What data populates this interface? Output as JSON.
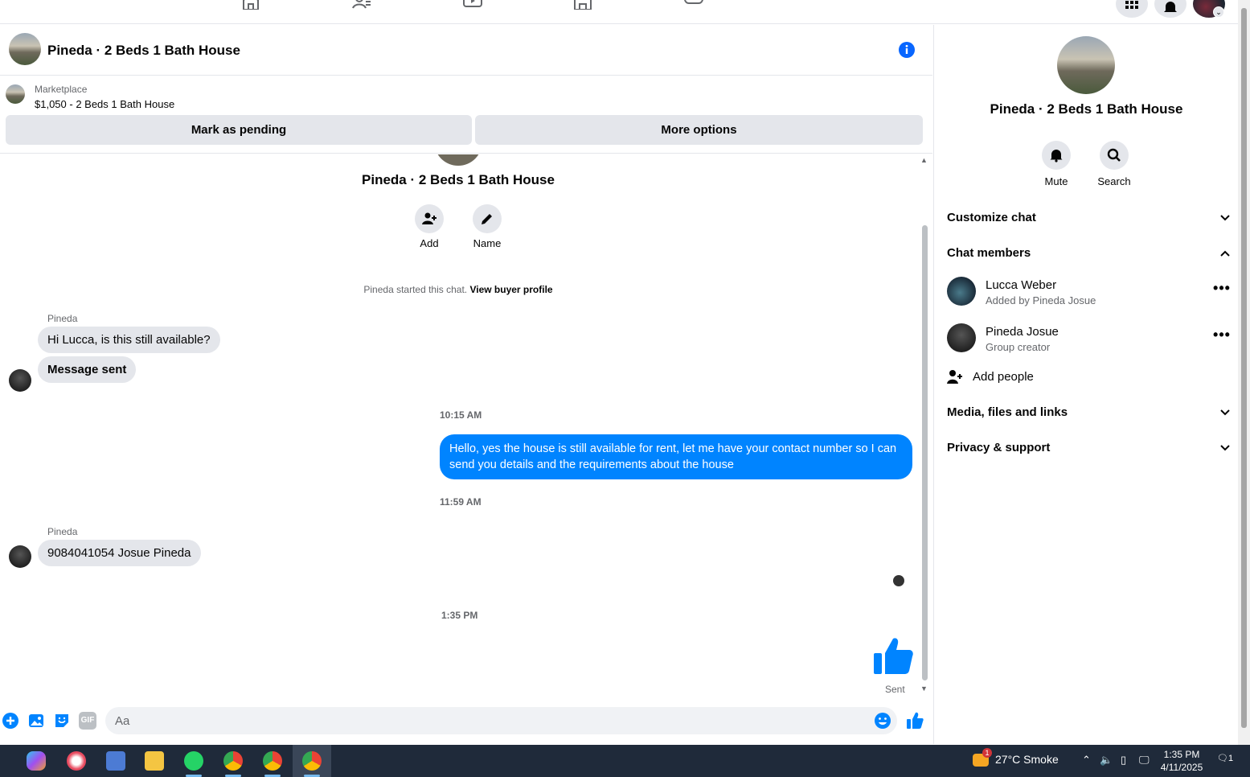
{
  "chat": {
    "title": "Pineda · 2 Beds 1 Bath House",
    "marketplace_label": "Marketplace",
    "listing": "$1,050 - 2 Beds 1 Bath House",
    "mark_pending": "Mark as pending",
    "more_options": "More options"
  },
  "convo": {
    "title": "Pineda · 2 Beds 1 Bath House",
    "add_label": "Add",
    "name_label": "Name",
    "started_text": "Pineda started this chat. ",
    "view_buyer": "View buyer profile",
    "sender1": "Pineda",
    "msg1": "Hi Lucca, is this still available?",
    "msg2": "Message sent",
    "ts1": "10:15 AM",
    "msg3": "Hello, yes the house is still available for rent, let me have your contact number so I can send you details and the requirements about the house",
    "ts2": "11:59 AM",
    "sender2": "Pineda",
    "msg4": "9084041054 Josue Pineda",
    "ts3": "1:35 PM",
    "sent": "Sent"
  },
  "composer": {
    "placeholder": "Aa",
    "gif_label": "GIF"
  },
  "panel": {
    "title": "Pineda · 2 Beds 1 Bath House",
    "mute": "Mute",
    "search": "Search",
    "customize": "Customize chat",
    "members": "Chat members",
    "member1_name": "Lucca Weber",
    "member1_sub": "Added by Pineda Josue",
    "member2_name": "Pineda Josue",
    "member2_sub": "Group creator",
    "more": "•••",
    "add_people": "Add people",
    "media": "Media, files and links",
    "privacy": "Privacy & support"
  },
  "taskbar": {
    "weather_badge": "1",
    "weather": "27°C  Smoke",
    "time": "1:35 PM",
    "date": "4/11/2025",
    "notif_count": "1"
  },
  "colors": {
    "accent": "#0084ff",
    "bubble_in": "#e4e6eb",
    "taskbar": "#1f2a3a"
  }
}
